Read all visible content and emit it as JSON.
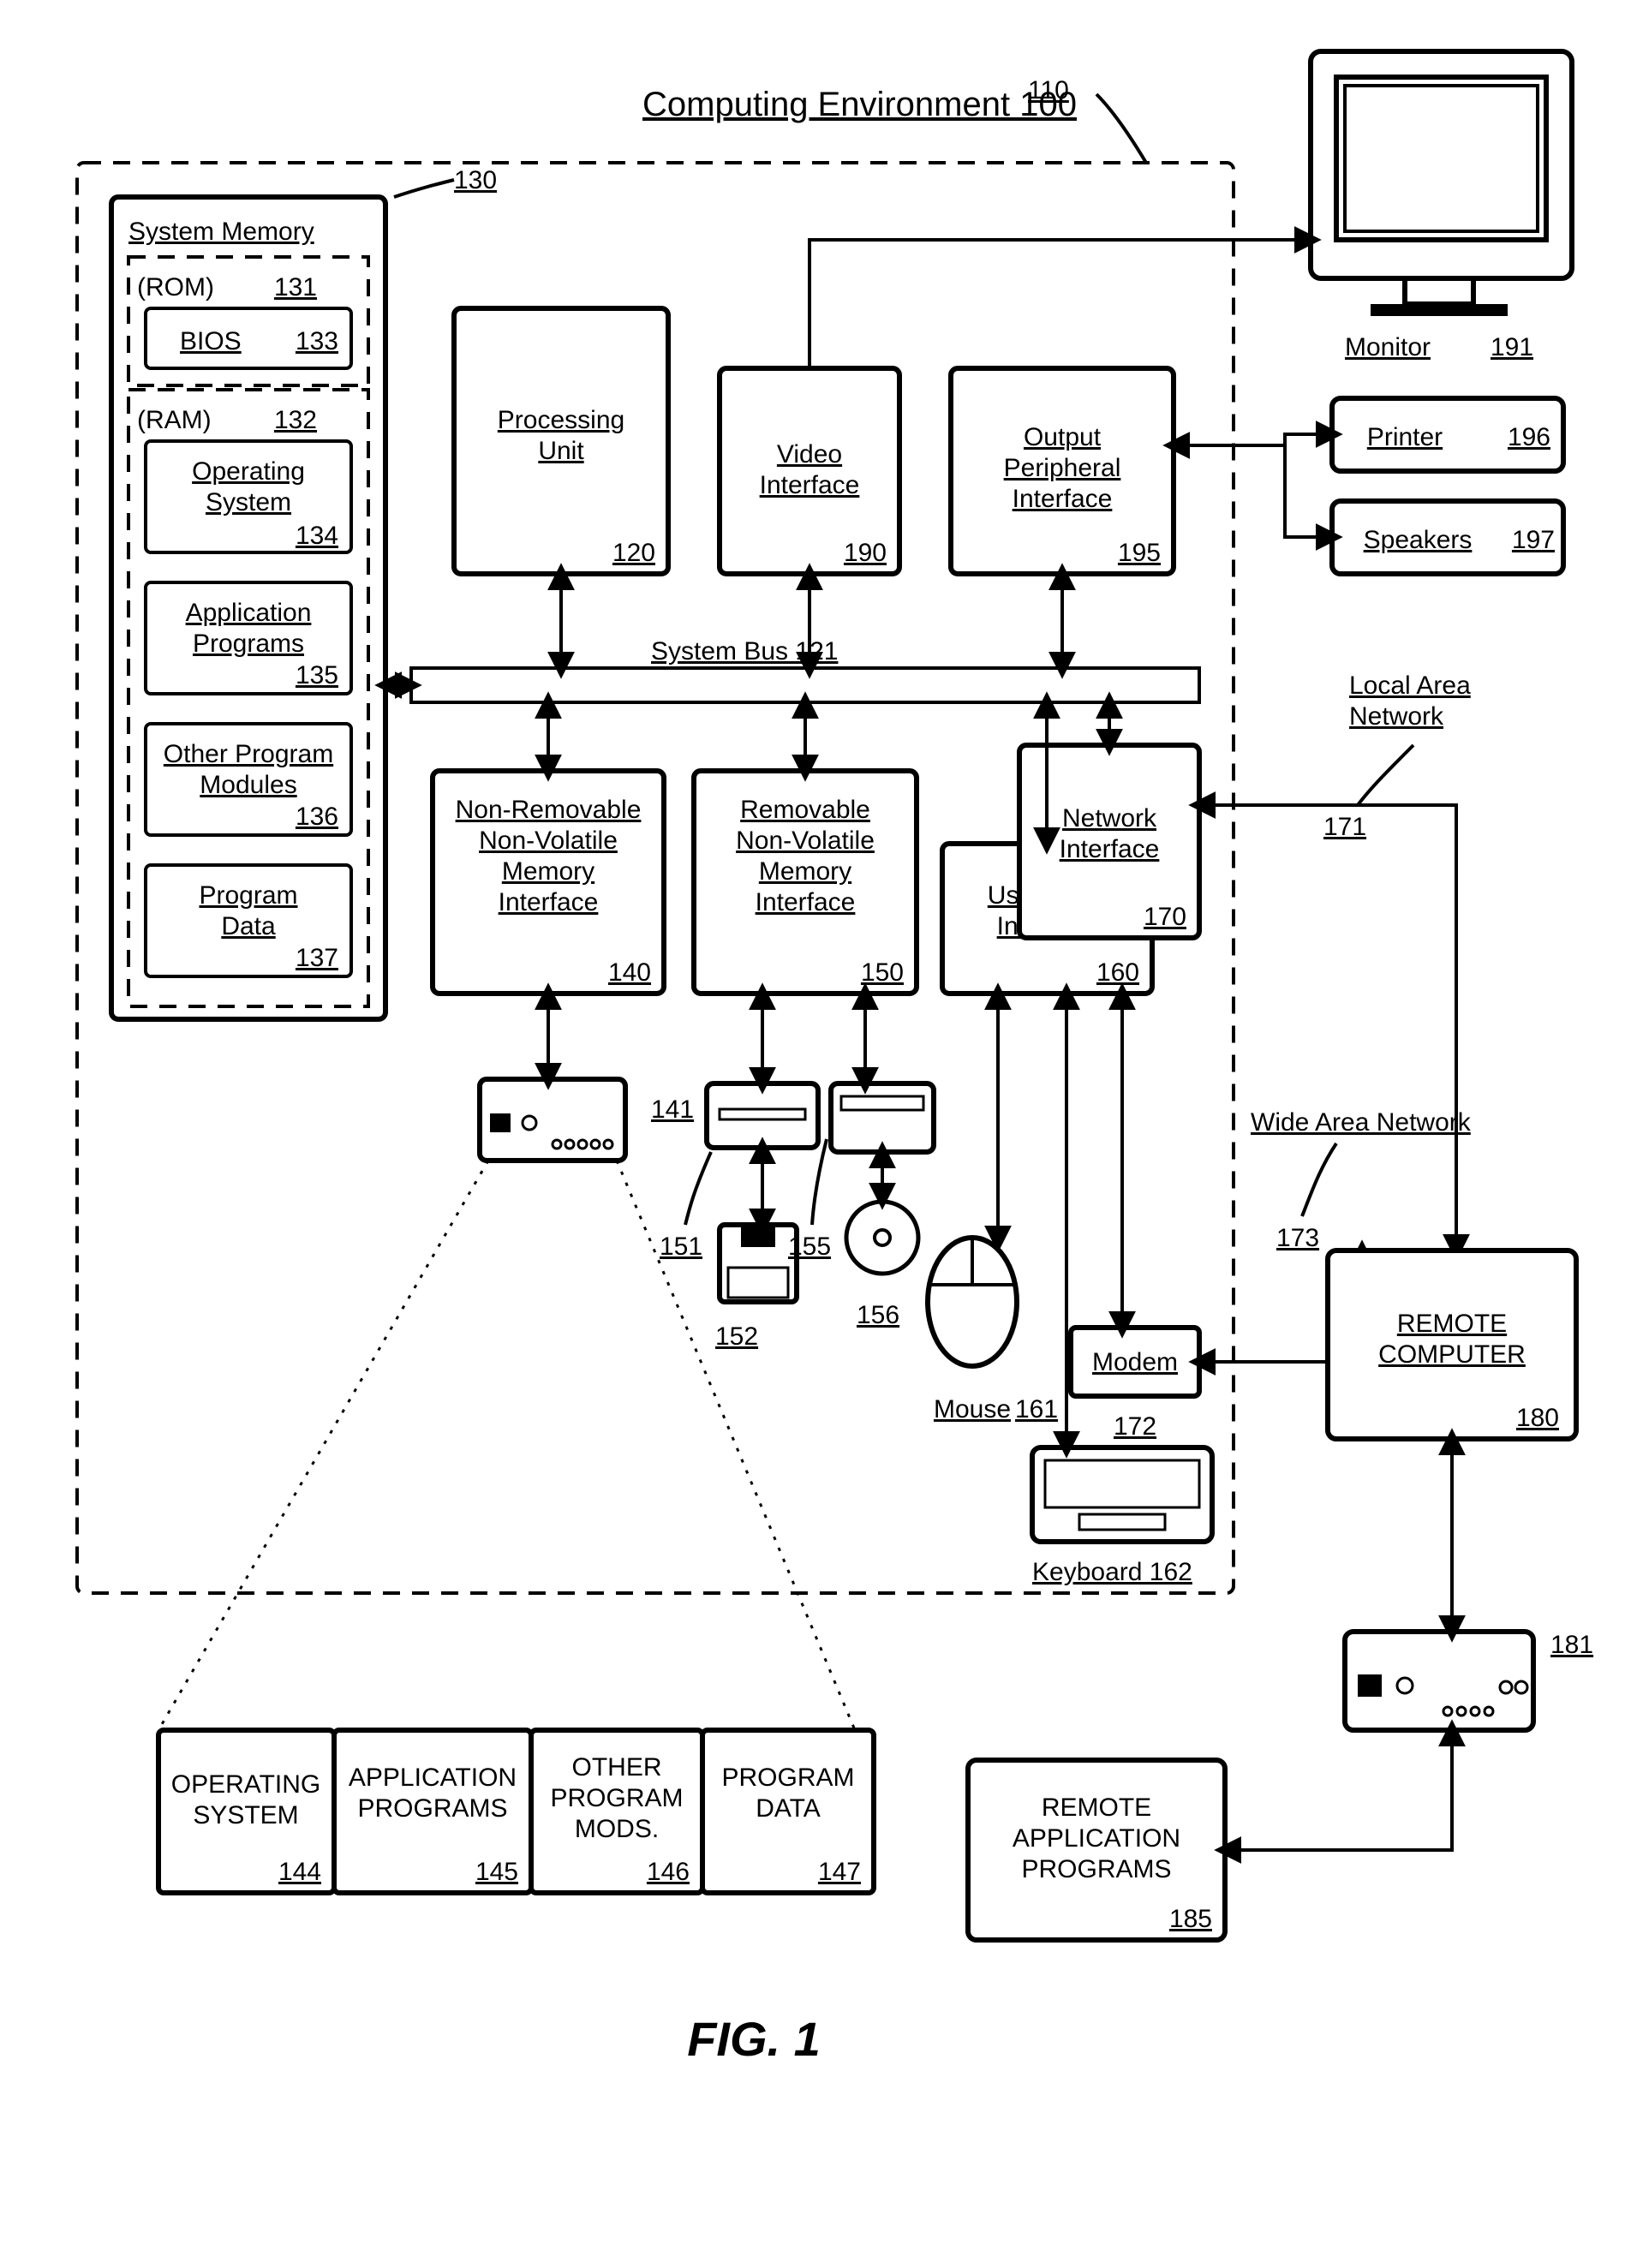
{
  "title": "Computing Environment 100",
  "fig": "FIG. 1",
  "sysmem": {
    "title": "System Memory",
    "rom": "(ROM)",
    "rom_ref": "131",
    "bios": "BIOS",
    "bios_ref": "133",
    "ram": "(RAM)",
    "ram_ref": "132",
    "os": "Operating\nSystem",
    "os_ref": "134",
    "apps": "Application\nPrograms",
    "apps_ref": "135",
    "mods": "Other Program\nModules",
    "mods_ref": "136",
    "data": "Program\nData",
    "data_ref": "137",
    "selfref": "130"
  },
  "pu": {
    "label": "Processing\nUnit",
    "ref": "120"
  },
  "bus": {
    "label": "System Bus 121"
  },
  "video": {
    "label": "Video\nInterface",
    "ref": "190"
  },
  "outp": {
    "label": "Output\nPeripheral\nInterface",
    "ref": "195"
  },
  "net": {
    "label": "Network\nInterface",
    "ref": "170"
  },
  "uin": {
    "label": "User Input\nInterface",
    "ref": "160"
  },
  "nrem": {
    "label": "Non-Removable\nNon-Volatile\nMemory\nInterface",
    "ref": "140"
  },
  "rem": {
    "label": "Removable\nNon-Volatile\nMemory\nInterface",
    "ref": "150"
  },
  "modem": {
    "label": "Modem",
    "ref": "172"
  },
  "env_ref": "110",
  "hdd_ref": "141",
  "floppy_drive_ref": "151",
  "floppy_ref": "152",
  "cd_drive_ref": "155",
  "cd_ref": "156",
  "mouse": {
    "label": "Mouse",
    "ref": "161"
  },
  "kbd": {
    "label": "Keyboard 162"
  },
  "monitor": {
    "label": "Monitor",
    "ref": "191"
  },
  "printer": {
    "label": "Printer",
    "ref": "196"
  },
  "speakers": {
    "label": "Speakers",
    "ref": "197"
  },
  "lan": {
    "label": "Local Area\nNetwork",
    "ref": "171"
  },
  "wan": {
    "label": "Wide Area Network",
    "ref": "173"
  },
  "remote_pc": {
    "label": "REMOTE\nCOMPUTER",
    "ref": "180"
  },
  "remote_apps": {
    "label": "REMOTE\nAPPLICATION\nPROGRAMS",
    "ref": "185"
  },
  "remote_hdd_ref": "181",
  "storage": {
    "os": {
      "label": "OPERATING\nSYSTEM",
      "ref": "144"
    },
    "apps": {
      "label": "APPLICATION\nPROGRAMS",
      "ref": "145"
    },
    "mods": {
      "label": "OTHER\nPROGRAM\nMODS.",
      "ref": "146"
    },
    "data": {
      "label": "PROGRAM\nDATA",
      "ref": "147"
    }
  }
}
